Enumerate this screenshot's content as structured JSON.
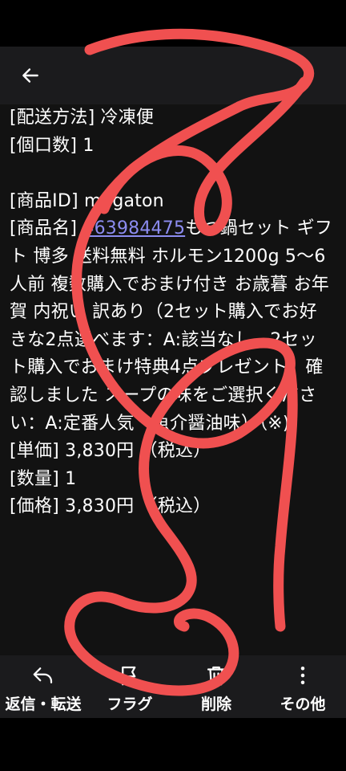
{
  "header": {
    "back_icon": "arrow-left-icon"
  },
  "message": {
    "delivery": "[配送方法] 冷凍便",
    "parcel_count": "[個口数] 1",
    "product_id": "[商品ID] megaton",
    "product_name_prefix": "[商品名] ",
    "product_link": "463984475",
    "product_name_rest": "もつ鍋セット ギフト 博多 送料無料 ホルモン1200g 5〜6人前 複数購入でおまけ付き お歳暮 お年賀 内祝い 訳あり（2セット購入でお好きな2点選べます：A:該当なし、2セット購入でおまけ特典4点プレゼント：確認しました スープの味をご選択ください：A:定番人気・魚介醤油味）（※)",
    "unit_price": "[単価] 3,830円 （税込）",
    "quantity": "[数量] 1",
    "price": "[価格] 3,830円 （税込）"
  },
  "toolbar": {
    "reply_forward": "返信・転送",
    "flag": "フラグ",
    "delete": "削除",
    "more": "その他"
  },
  "colors": {
    "link": "#8c8cf0",
    "scribble": "#f05050",
    "background": "#121212",
    "bar": "#1b1b1d"
  }
}
